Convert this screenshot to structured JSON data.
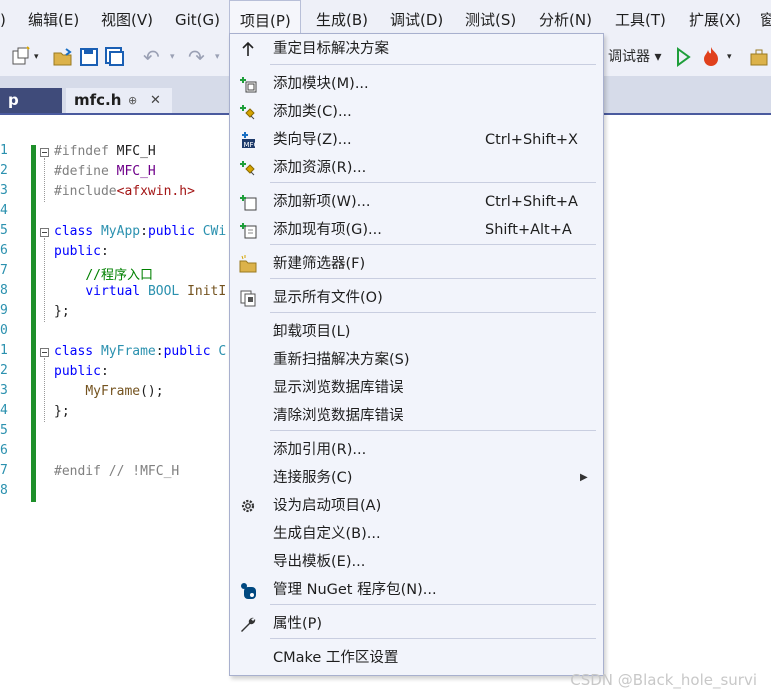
{
  "menubar": {
    "items": [
      {
        "label": ")"
      },
      {
        "label": "编辑(E)"
      },
      {
        "label": "视图(V)"
      },
      {
        "label": "Git(G)"
      },
      {
        "label": "项目(P)"
      },
      {
        "label": "生成(B)"
      },
      {
        "label": "调试(D)"
      },
      {
        "label": "测试(S)"
      },
      {
        "label": "分析(N)"
      },
      {
        "label": "工具(T)"
      },
      {
        "label": "扩展(X)"
      },
      {
        "label": "窗"
      }
    ]
  },
  "toolbar": {
    "debugger_label": "调试器 ▾"
  },
  "tabs": [
    {
      "label": "p"
    },
    {
      "label": "mfc.h",
      "pin": "⊕",
      "close": "✕"
    }
  ],
  "editor": {
    "line_numbers": [
      "1",
      "2",
      "3",
      "4",
      "5",
      "6",
      "7",
      "8",
      "9",
      "0",
      "1",
      "2",
      "3",
      "4",
      "5",
      "6",
      "7",
      "8"
    ],
    "lines": [
      [
        {
          "c": "pp",
          "t": "#ifndef "
        },
        {
          "c": "tx",
          "t": "MFC_H"
        }
      ],
      [
        {
          "c": "pp",
          "t": "#define "
        },
        {
          "c": "mac",
          "t": "MFC_H"
        }
      ],
      [
        {
          "c": "pp",
          "t": "#include"
        },
        {
          "c": "str",
          "t": "<afxwin.h>"
        }
      ],
      [],
      [
        {
          "c": "kw",
          "t": "class "
        },
        {
          "c": "ty",
          "t": "MyApp"
        },
        {
          "c": "tx",
          "t": ":"
        },
        {
          "c": "kw",
          "t": "public "
        },
        {
          "c": "ty",
          "t": "CWi"
        }
      ],
      [
        {
          "c": "kw",
          "t": "public"
        },
        {
          "c": "tx",
          "t": ":"
        }
      ],
      [
        {
          "c": "tx",
          "t": "    "
        },
        {
          "c": "cm",
          "t": "//程序入口"
        }
      ],
      [
        {
          "c": "tx",
          "t": "    "
        },
        {
          "c": "kw",
          "t": "virtual "
        },
        {
          "c": "ty",
          "t": "BOOL "
        },
        {
          "c": "fn",
          "t": "InitI"
        }
      ],
      [
        {
          "c": "tx",
          "t": "};"
        }
      ],
      [],
      [
        {
          "c": "kw",
          "t": "class "
        },
        {
          "c": "ty",
          "t": "MyFrame"
        },
        {
          "c": "tx",
          "t": ":"
        },
        {
          "c": "kw",
          "t": "public "
        },
        {
          "c": "ty",
          "t": "C"
        }
      ],
      [
        {
          "c": "kw",
          "t": "public"
        },
        {
          "c": "tx",
          "t": ":"
        }
      ],
      [
        {
          "c": "tx",
          "t": "    "
        },
        {
          "c": "fn",
          "t": "MyFrame"
        },
        {
          "c": "tx",
          "t": "();"
        }
      ],
      [
        {
          "c": "tx",
          "t": "};"
        }
      ],
      [],
      [],
      [
        {
          "c": "pp",
          "t": "#endif // !MFC_H"
        }
      ],
      []
    ]
  },
  "project_menu": {
    "items": [
      {
        "label": "重定目标解决方案",
        "icon": "arrow-up-icon",
        "shortcut": ""
      },
      {
        "label": "添加模块(M)...",
        "icon": "add-module-icon",
        "shortcut": ""
      },
      {
        "label": "添加类(C)...",
        "icon": "add-class-icon",
        "shortcut": ""
      },
      {
        "label": "类向导(Z)...",
        "icon": "class-wizard-icon",
        "shortcut": "Ctrl+Shift+X"
      },
      {
        "label": "添加资源(R)...",
        "icon": "add-resource-icon",
        "shortcut": ""
      },
      {
        "label": "添加新项(W)...",
        "icon": "add-new-item-icon",
        "shortcut": "Ctrl+Shift+A"
      },
      {
        "label": "添加现有项(G)...",
        "icon": "add-existing-item-icon",
        "shortcut": "Shift+Alt+A"
      },
      {
        "label": "新建筛选器(F)",
        "icon": "new-filter-icon",
        "shortcut": ""
      },
      {
        "label": "显示所有文件(O)",
        "icon": "show-all-files-icon",
        "shortcut": ""
      },
      {
        "label": "卸载项目(L)",
        "icon": "",
        "shortcut": ""
      },
      {
        "label": "重新扫描解决方案(S)",
        "icon": "",
        "shortcut": ""
      },
      {
        "label": "显示浏览数据库错误",
        "icon": "",
        "shortcut": ""
      },
      {
        "label": "清除浏览数据库错误",
        "icon": "",
        "shortcut": ""
      },
      {
        "label": "添加引用(R)...",
        "icon": "",
        "shortcut": ""
      },
      {
        "label": "连接服务(C)",
        "icon": "",
        "shortcut": "",
        "submenu": "▶"
      },
      {
        "label": "设为启动项目(A)",
        "icon": "gear-icon",
        "shortcut": ""
      },
      {
        "label": "生成自定义(B)...",
        "icon": "",
        "shortcut": ""
      },
      {
        "label": "导出模板(E)...",
        "icon": "",
        "shortcut": ""
      },
      {
        "label": "管理 NuGet 程序包(N)...",
        "icon": "nuget-icon",
        "shortcut": ""
      },
      {
        "label": "属性(P)",
        "icon": "wrench-icon",
        "shortcut": ""
      },
      {
        "label": "CMake 工作区设置",
        "icon": "",
        "shortcut": ""
      }
    ]
  },
  "watermark": "CSDN @Black_hole_survi",
  "colors": {
    "accent": "#4a5a9e",
    "menu_bg": "#f2f4fb",
    "green_bar": "#1e8f2a"
  }
}
